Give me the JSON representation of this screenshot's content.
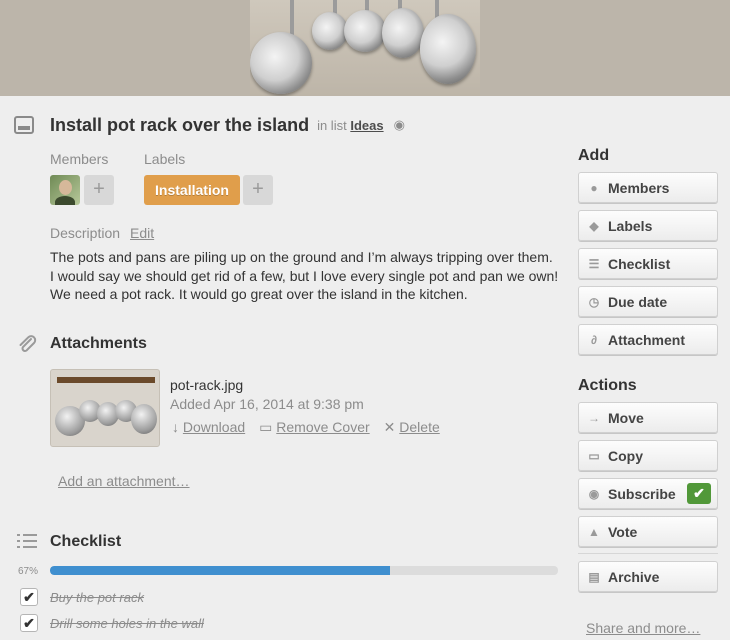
{
  "card": {
    "title": "Install pot rack over the island",
    "in_list_prefix": "in list",
    "list_name": "Ideas",
    "members_label": "Members",
    "labels_label": "Labels",
    "label_chip": "Installation",
    "description_label": "Description",
    "edit_label": "Edit",
    "description": "The pots and pans are piling up on the ground and I’m always tripping over them. I would say we should get rid of a few, but I love every single pot and pan we own! We need a pot rack. It would go great over the island in the kitchen."
  },
  "attachments": {
    "title": "Attachments",
    "file_name": "pot-rack.jpg",
    "added": "Added Apr 16, 2014 at 9:38 pm",
    "download": "Download",
    "remove_cover": "Remove Cover",
    "delete": "Delete",
    "add_link": "Add an attachment…"
  },
  "checklist": {
    "title": "Checklist",
    "percent_text": "67%",
    "progress": 0.67,
    "items": [
      {
        "text": "Buy the pot rack",
        "checked": true
      },
      {
        "text": "Drill some holes in the wall",
        "checked": true
      }
    ]
  },
  "sidebar": {
    "add_title": "Add",
    "add_buttons": [
      {
        "label": "Members",
        "icon": "person-icon"
      },
      {
        "label": "Labels",
        "icon": "tag-icon"
      },
      {
        "label": "Checklist",
        "icon": "checklist-icon"
      },
      {
        "label": "Due date",
        "icon": "clock-icon"
      },
      {
        "label": "Attachment",
        "icon": "paperclip-icon"
      }
    ],
    "actions_title": "Actions",
    "action_buttons": [
      {
        "label": "Move",
        "icon": "arrow-right-icon"
      },
      {
        "label": "Copy",
        "icon": "card-icon"
      },
      {
        "label": "Subscribe",
        "icon": "eye-icon"
      },
      {
        "label": "Vote",
        "icon": "thumbs-up-icon"
      },
      {
        "label": "Archive",
        "icon": "archive-icon"
      }
    ],
    "share_link": "Share and more…"
  },
  "colors": {
    "label_orange": "#e09e4b",
    "progress_blue": "#3f8fcf",
    "subscribe_green": "#519839"
  }
}
